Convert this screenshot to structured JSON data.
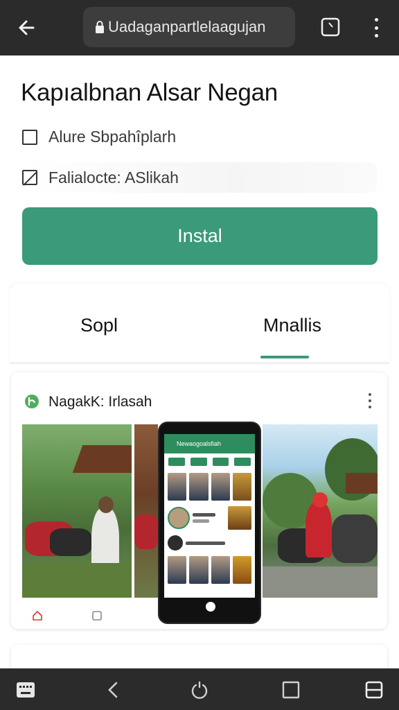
{
  "browser": {
    "url": "Uadaganpartlelaagujan",
    "icons": [
      "back-arrow-icon",
      "lock-icon",
      "tab-switcher-icon",
      "more-vert-icon"
    ]
  },
  "app": {
    "title": "Kapıalbnan Alsar Negan",
    "options": [
      {
        "label": "Alure Sbpahîplarh",
        "icon": "checkbox-empty-icon"
      },
      {
        "label": "Falialocte: ASlikah",
        "icon": "checkbox-slash-icon"
      }
    ],
    "install_label": "Instal",
    "accent": "#3a9a79"
  },
  "tabs": [
    {
      "label": "Sopl",
      "selected": false
    },
    {
      "label": "Mnallis",
      "selected": true
    }
  ],
  "post": {
    "name": "NagakK: Irlasah",
    "phone_header": "Newaogoalsfiah",
    "icons": [
      "leaf-logo-icon",
      "more-vert-icon",
      "home-icon",
      "photo-icon"
    ]
  },
  "navbar": {
    "icons": [
      "keyboard-icon",
      "back-chevron-icon",
      "power-icon",
      "square-icon",
      "recents-icon"
    ]
  }
}
